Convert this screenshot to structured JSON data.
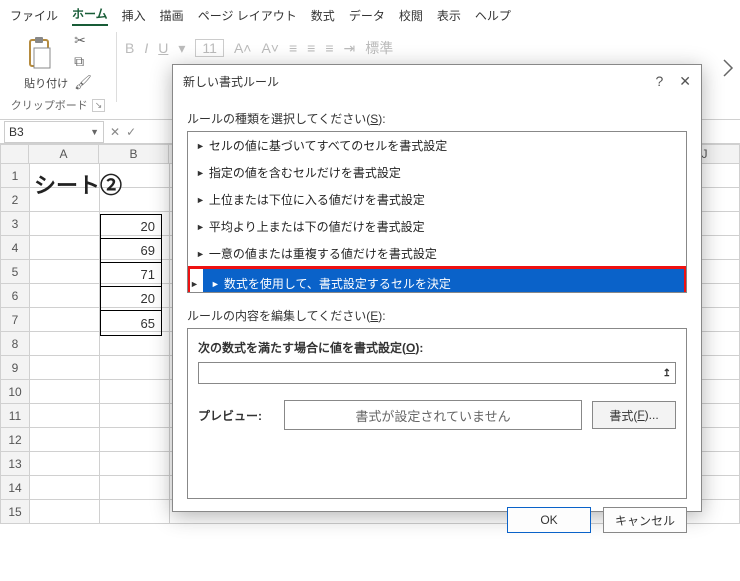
{
  "menu": {
    "items": [
      "ファイル",
      "ホーム",
      "挿入",
      "描画",
      "ページ レイアウト",
      "数式",
      "データ",
      "校閲",
      "表示",
      "ヘルプ"
    ],
    "active_index": 1
  },
  "ribbon": {
    "paste_label": "貼り付け",
    "clipboard_caption": "クリップボード",
    "font_size": "11",
    "style_label": "標準"
  },
  "namebox": {
    "ref": "B3"
  },
  "columns": [
    "A",
    "B",
    "",
    "",
    "",
    "",
    "",
    "",
    "J"
  ],
  "rows": [
    "1",
    "2",
    "3",
    "4",
    "5",
    "6",
    "7",
    "8",
    "9",
    "10",
    "11",
    "12",
    "13",
    "14",
    "15"
  ],
  "sheet_title": "シート②",
  "data_values": [
    "20",
    "69",
    "71",
    "20",
    "65"
  ],
  "dialog": {
    "title": "新しい書式ルール",
    "rule_type_label_pre": "ルールの種類を選択してください(",
    "rule_type_key": "S",
    "rule_type_label_post": "):",
    "rules": [
      "セルの値に基づいてすべてのセルを書式設定",
      "指定の値を含むセルだけを書式設定",
      "上位または下位に入る値だけを書式設定",
      "平均より上または下の値だけを書式設定",
      "一意の値または重複する値だけを書式設定",
      "数式を使用して、書式設定するセルを決定"
    ],
    "selected_rule_index": 5,
    "desc_label_pre": "ルールの内容を編集してください(",
    "desc_key": "E",
    "desc_label_post": "):",
    "formula_heading_pre": "次の数式を満たす場合に値を書式設定(",
    "formula_key": "O",
    "formula_heading_post": "):",
    "preview_label": "プレビュー:",
    "preview_text": "書式が設定されていません",
    "format_btn_pre": "書式(",
    "format_btn_key": "F",
    "format_btn_post": ")...",
    "ok": "OK",
    "cancel": "キャンセル"
  }
}
